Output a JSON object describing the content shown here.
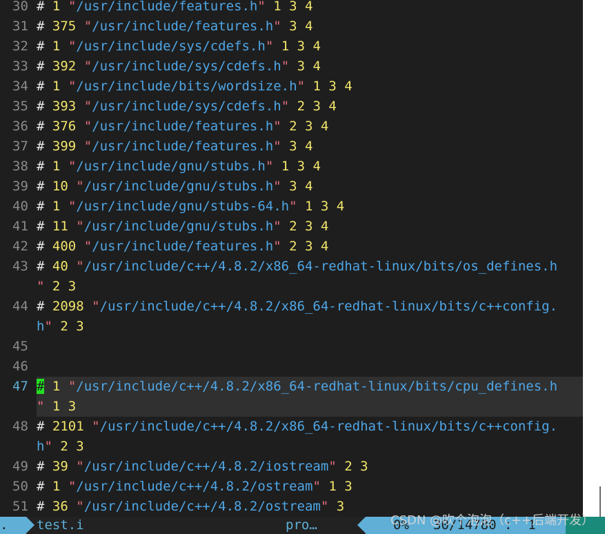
{
  "editor": {
    "rows": [
      {
        "num": "30",
        "hash": "#",
        "n": "1",
        "path": "/usr/include/features.h",
        "tail": "1 3 4",
        "close": "\""
      },
      {
        "num": "31",
        "hash": "#",
        "n": "375",
        "path": "/usr/include/features.h",
        "tail": "3 4",
        "close": "\""
      },
      {
        "num": "32",
        "hash": "#",
        "n": "1",
        "path": "/usr/include/sys/cdefs.h",
        "tail": "1 3 4",
        "close": "\""
      },
      {
        "num": "33",
        "hash": "#",
        "n": "392",
        "path": "/usr/include/sys/cdefs.h",
        "tail": "3 4",
        "close": "\""
      },
      {
        "num": "34",
        "hash": "#",
        "n": "1",
        "path": "/usr/include/bits/wordsize.h",
        "tail": "1 3 4",
        "close": "\""
      },
      {
        "num": "35",
        "hash": "#",
        "n": "393",
        "path": "/usr/include/sys/cdefs.h",
        "tail": "2 3 4",
        "close": "\""
      },
      {
        "num": "36",
        "hash": "#",
        "n": "376",
        "path": "/usr/include/features.h",
        "tail": "2 3 4",
        "close": "\""
      },
      {
        "num": "37",
        "hash": "#",
        "n": "399",
        "path": "/usr/include/features.h",
        "tail": "3 4",
        "close": "\""
      },
      {
        "num": "38",
        "hash": "#",
        "n": "1",
        "path": "/usr/include/gnu/stubs.h",
        "tail": "1 3 4",
        "close": "\""
      },
      {
        "num": "39",
        "hash": "#",
        "n": "10",
        "path": "/usr/include/gnu/stubs.h",
        "tail": "3 4",
        "close": "\""
      },
      {
        "num": "40",
        "hash": "#",
        "n": "1",
        "path": "/usr/include/gnu/stubs-64.h",
        "tail": "1 3 4",
        "close": "\""
      },
      {
        "num": "41",
        "hash": "#",
        "n": "11",
        "path": "/usr/include/gnu/stubs.h",
        "tail": "2 3 4",
        "close": "\""
      },
      {
        "num": "42",
        "hash": "#",
        "n": "400",
        "path": "/usr/include/features.h",
        "tail": "2 3 4",
        "close": "\""
      },
      {
        "num": "43",
        "hash": "#",
        "n": "40",
        "path": "/usr/include/c++/4.8.2/x86_64-redhat-linux/bits/os_defines.h",
        "tail": "",
        "close": ""
      },
      {
        "num": "",
        "hash": "",
        "n": "",
        "path": "",
        "tail": "2 3",
        "close": "\""
      },
      {
        "num": "44",
        "hash": "#",
        "n": "2098",
        "path": "/usr/include/c++/4.8.2/x86_64-redhat-linux/bits/c++config.",
        "tail": "",
        "close": ""
      },
      {
        "num": "",
        "hash": "",
        "n": "",
        "path": "h",
        "tail": "2 3",
        "close": "\""
      },
      {
        "num": "45",
        "hash": "",
        "n": "",
        "path": "",
        "tail": "",
        "close": ""
      },
      {
        "num": "46",
        "hash": "",
        "n": "",
        "path": "",
        "tail": "",
        "close": ""
      },
      {
        "num": "47",
        "hash": "#",
        "n": "1",
        "path": "/usr/include/c++/4.8.2/x86_64-redhat-linux/bits/cpu_defines.h",
        "tail": "",
        "close": "",
        "current": true
      },
      {
        "num": "",
        "hash": "",
        "n": "",
        "path": "",
        "tail": "1 3",
        "close": "\"",
        "current": true
      },
      {
        "num": "48",
        "hash": "#",
        "n": "2101",
        "path": "/usr/include/c++/4.8.2/x86_64-redhat-linux/bits/c++config.",
        "tail": "",
        "close": ""
      },
      {
        "num": "",
        "hash": "",
        "n": "",
        "path": "h",
        "tail": "2 3",
        "close": "\""
      },
      {
        "num": "49",
        "hash": "#",
        "n": "39",
        "path": "/usr/include/c++/4.8.2/iostream",
        "tail": "2 3",
        "close": "\""
      },
      {
        "num": "50",
        "hash": "#",
        "n": "1",
        "path": "/usr/include/c++/4.8.2/ostream",
        "tail": "1 3",
        "close": "\""
      },
      {
        "num": "51",
        "hash": "#",
        "n": "36",
        "path": "/usr/include/c++/4.8.2/ostream",
        "tail": "3",
        "close": "\""
      }
    ]
  },
  "statusline": {
    "mode": ".",
    "file": "test.i",
    "filetype": "pro…",
    "percent": "0%",
    "position": "30/14780 :  1"
  },
  "watermark": "CSDN @吹个泡泡（c++后端开发）",
  "colors": {
    "background": "#1e1e1e",
    "line_number": "#8a8a8a",
    "number": "#f2e56b",
    "quote": "#e36f7d",
    "path": "#4fa6e6",
    "cursor": "#22e022",
    "accent": "#5fafd7"
  }
}
